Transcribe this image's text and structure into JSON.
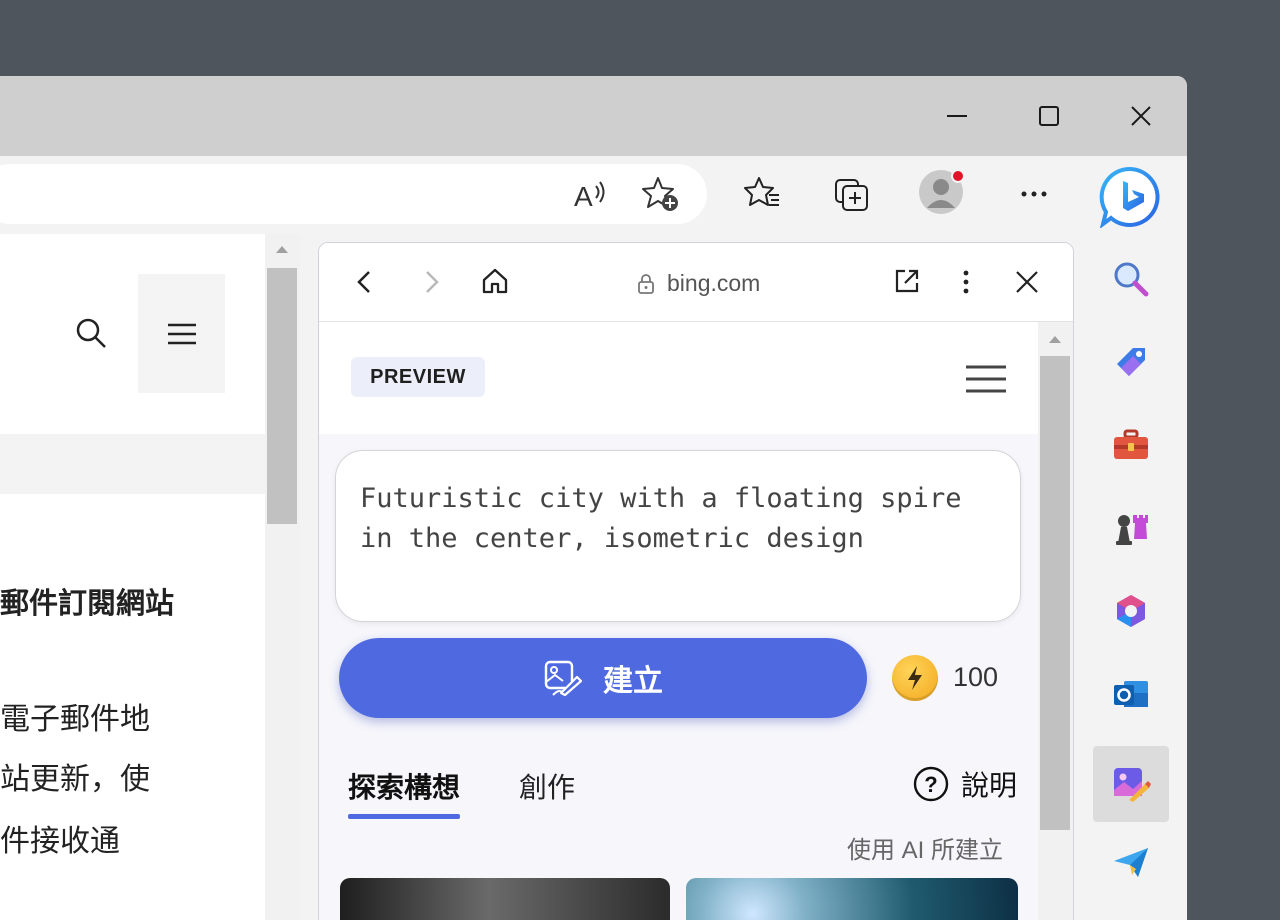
{
  "browser": {
    "address_url": "bing.com",
    "window_controls": [
      "minimize",
      "maximize",
      "close"
    ]
  },
  "webpage": {
    "text_lines": [
      "郵件訂閱網站",
      "電子郵件地",
      "站更新，使",
      "件接收通"
    ]
  },
  "panel": {
    "url": "bing.com",
    "preview_badge": "PREVIEW",
    "prompt_text": "Futuristic city with a floating spire in the center, isometric design",
    "create_label": "建立",
    "boost_count": "100",
    "tabs": [
      {
        "label": "探索構想",
        "active": true
      },
      {
        "label": "創作",
        "active": false
      }
    ],
    "help_label": "說明",
    "ai_caption": "使用 AI 所建立"
  },
  "sidebar": {
    "items": [
      "search-icon",
      "tag-icon",
      "toolbox-icon",
      "chess-icon",
      "office-icon",
      "outlook-icon",
      "image-creator-icon",
      "send-icon"
    ],
    "active_index": 6
  },
  "colors": {
    "accent": "#4f6ae0",
    "titlebar": "#cfcfcf",
    "notification_dot": "#e0142b"
  }
}
